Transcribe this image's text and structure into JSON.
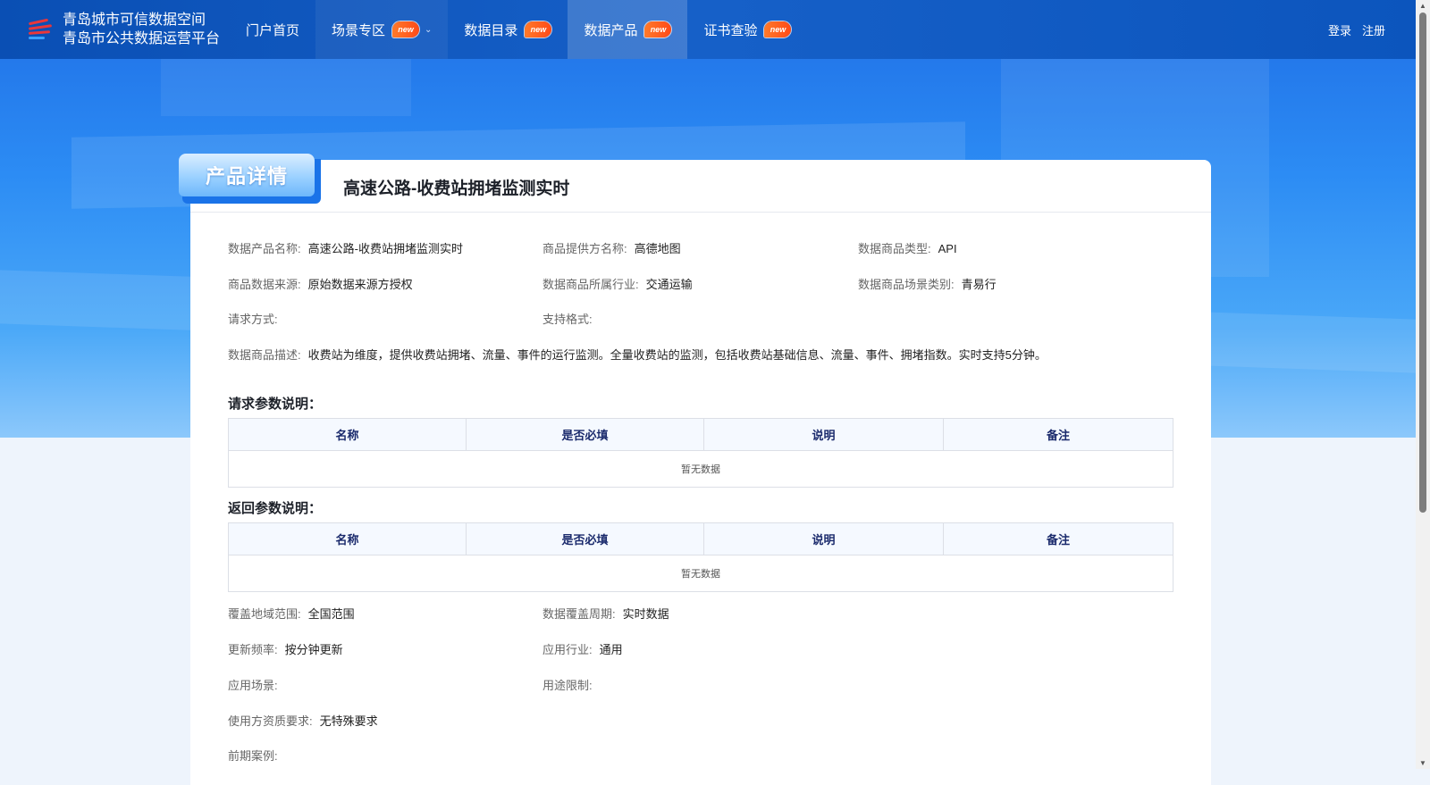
{
  "header": {
    "logo_line1": "青岛城市可信数据空间",
    "logo_line2": "青岛市公共数据运营平台",
    "nav": [
      {
        "label": "门户首页",
        "badge": ""
      },
      {
        "label": "场景专区",
        "badge": "new"
      },
      {
        "label": "数据目录",
        "badge": "new"
      },
      {
        "label": "数据产品",
        "badge": "new"
      },
      {
        "label": "证书查验",
        "badge": "new"
      }
    ],
    "login": "登录",
    "register": "注册"
  },
  "card": {
    "tag": "产品详情",
    "title": "高速公路-收费站拥堵监测实时"
  },
  "info": {
    "name_k": "数据产品名称:",
    "name_v": "高速公路-收费站拥堵监测实时",
    "provider_k": "商品提供方名称:",
    "provider_v": "高德地图",
    "type_k": "数据商品类型:",
    "type_v": "API",
    "source_k": "商品数据来源:",
    "source_v": "原始数据来源方授权",
    "industry_k": "数据商品所属行业:",
    "industry_v": "交通运输",
    "scene_k": "数据商品场景类别:",
    "scene_v": "青易行",
    "method_k": "请求方式:",
    "method_v": "",
    "format_k": "支持格式:",
    "format_v": "",
    "desc_k": "数据商品描述:",
    "desc_v": "收费站为维度，提供收费站拥堵、流量、事件的运行监测。全量收费站的监测，包括收费站基础信息、流量、事件、拥堵指数。实时支持5分钟。"
  },
  "request_params": {
    "title": "请求参数说明：",
    "columns": [
      "名称",
      "是否必填",
      "说明",
      "备注"
    ],
    "empty": "暂无数据"
  },
  "response_params": {
    "title": "返回参数说明：",
    "columns": [
      "名称",
      "是否必填",
      "说明",
      "备注"
    ],
    "empty": "暂无数据"
  },
  "extra": {
    "region_k": "覆盖地域范围:",
    "region_v": "全国范围",
    "period_k": "数据覆盖周期:",
    "period_v": "实时数据",
    "freq_k": "更新频率:",
    "freq_v": "按分钟更新",
    "app_industry_k": "应用行业:",
    "app_industry_v": "通用",
    "app_scene_k": "应用场景:",
    "app_scene_v": "",
    "limit_k": "用途限制:",
    "limit_v": "",
    "qual_k": "使用方资质要求:",
    "qual_v": "无特殊要求",
    "cases_k": "前期案例:"
  }
}
